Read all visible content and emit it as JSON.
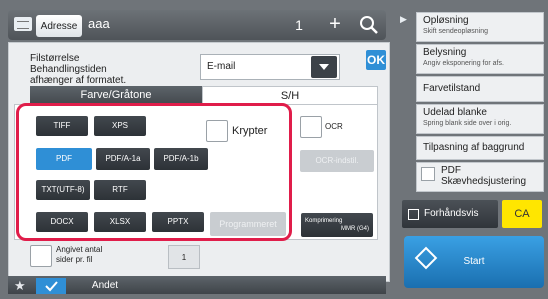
{
  "topbar": {
    "address_label": "Adresse",
    "address_value": "aaa",
    "count": "1",
    "plus_glyph": "+",
    "search_icon": "search-icon"
  },
  "filesize": {
    "label_line1": "Filstørrelse",
    "label_line2": "Behandlingstiden",
    "label_line3": "afhænger af formatet.",
    "selected": "E-mail"
  },
  "ok_label": "OK",
  "tabs": [
    {
      "label": "Farve/Gråtone"
    },
    {
      "label": "S/H"
    }
  ],
  "formats": {
    "row1": [
      "TIFF",
      "XPS"
    ],
    "row2": [
      "PDF",
      "PDF/A-1a",
      "PDF/A-1b"
    ],
    "row3": [
      "TXT(UTF-8)",
      "RTF"
    ],
    "row4": [
      "DOCX",
      "XLSX",
      "PPTX"
    ],
    "selected": "PDF"
  },
  "krypter_label": "Krypter",
  "ocr_label": "OCR",
  "ocr_settings_label": "OCR-indstil.",
  "programmeret_label": "Programmeret",
  "compression": {
    "label": "Komprimering",
    "value": "MMR (G4)"
  },
  "pages_per_file": {
    "label_line1": "Angivet antal",
    "label_line2": "sider pr. fil",
    "value": "1"
  },
  "bottombar": {
    "star_icon": "star-icon",
    "check_icon": "check-icon",
    "andet_label": "Andet"
  },
  "right_panel": {
    "items": [
      {
        "title": "Opløsning",
        "sub": "Skift sendeopløsning"
      },
      {
        "title": "Belysning",
        "sub": "Angiv eksponering for afs."
      },
      {
        "title": "Farvetilstand",
        "sub": ""
      },
      {
        "title": "Udelad blanke",
        "sub": "Spring blank side over i orig."
      },
      {
        "title": "Tilpasning af baggrund",
        "sub": ""
      },
      {
        "title": "PDF",
        "sub": "Skævhedsjustering"
      }
    ],
    "preview_label": "Forhåndsvis",
    "ca_label": "CA",
    "start_label": "Start"
  },
  "colors": {
    "accent_blue": "#2f8fd6",
    "highlight_red": "#e01d4a",
    "ca_yellow": "#ffe600"
  }
}
